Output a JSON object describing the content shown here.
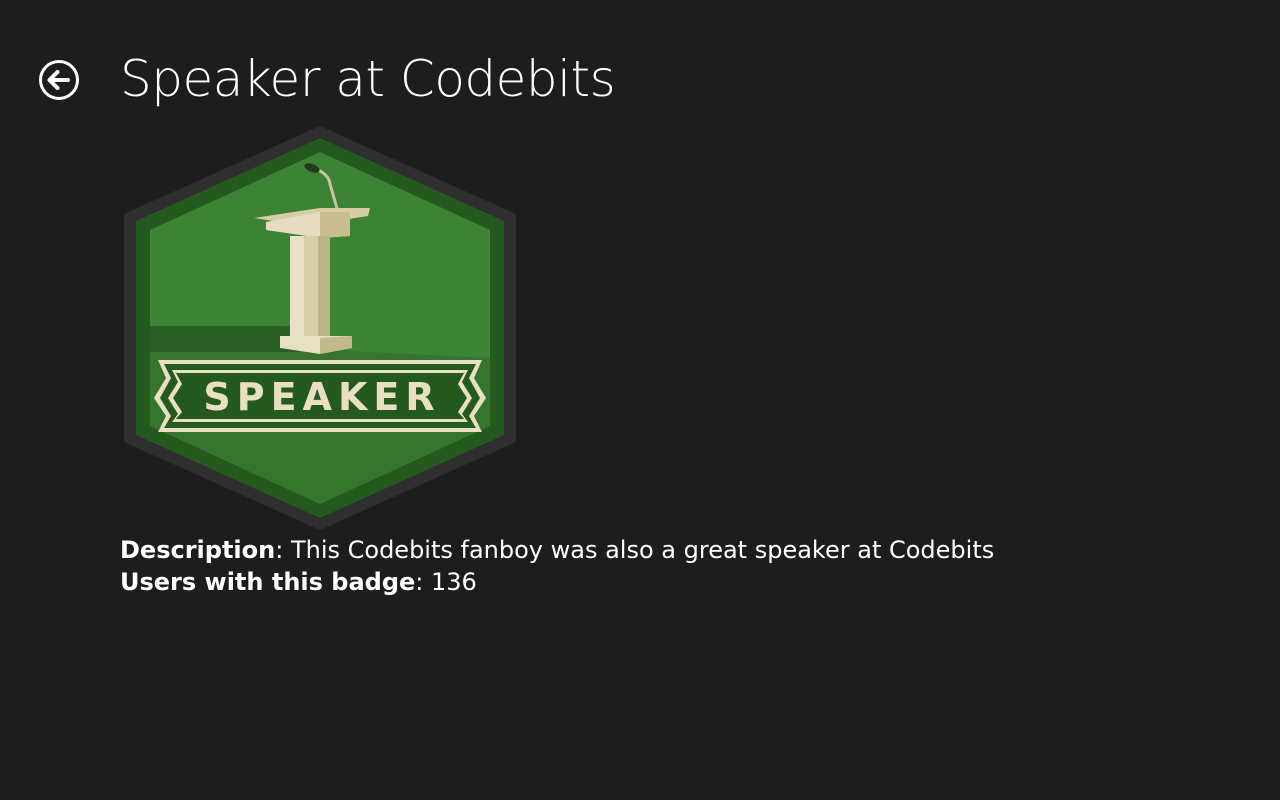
{
  "header": {
    "back_icon": "arrow-left-circle-icon",
    "title": "Speaker at Codebits"
  },
  "badge": {
    "image_text": "SPEAKER",
    "icon": "podium-microphone-icon",
    "colors": {
      "frame": "#2f2f2f",
      "outer_green": "#255a1e",
      "inner_green": "#3c8334",
      "cream": "#e9e0c4"
    }
  },
  "details": {
    "description_label": "Description",
    "description_sep": ":",
    "description_value": " This Codebits fanboy was also a great speaker at Codebits",
    "users_label": "Users with this badge",
    "users_sep": ":",
    "users_value": " 136"
  }
}
